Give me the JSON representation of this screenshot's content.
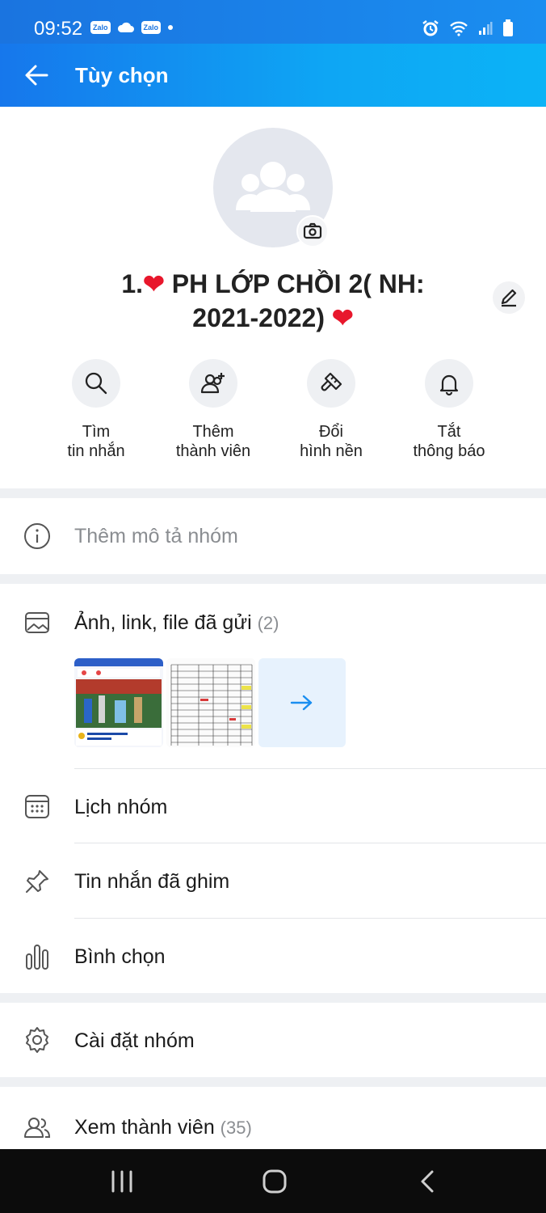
{
  "status_bar": {
    "time": "09:52",
    "zalo1": "Zalo",
    "zalo2": "Zalo"
  },
  "appbar": {
    "title": "Tùy chọn"
  },
  "group": {
    "name_line1": "1.",
    "name_line1b": " PH LỚP CHỒI 2( NH:",
    "name_line2": "2021-2022) ",
    "heart": "❤"
  },
  "actions": [
    {
      "line1": "Tìm",
      "line2": "tin nhắn"
    },
    {
      "line1": "Thêm",
      "line2": "thành viên"
    },
    {
      "line1": "Đổi",
      "line2": "hình nền"
    },
    {
      "line1": "Tắt",
      "line2": "thông báo"
    }
  ],
  "description": {
    "placeholder": "Thêm mô tả nhóm"
  },
  "media": {
    "label": "Ảnh, link, file đã gửi",
    "count": "(2)"
  },
  "menu": {
    "calendar": "Lịch nhóm",
    "pinned": "Tin nhắn đã ghim",
    "poll": "Bình chọn",
    "settings": "Cài đặt nhóm",
    "members": "Xem thành viên",
    "members_count": "(35)"
  },
  "colors": {
    "brand": "#1677ec",
    "heart": "#e8172c"
  }
}
